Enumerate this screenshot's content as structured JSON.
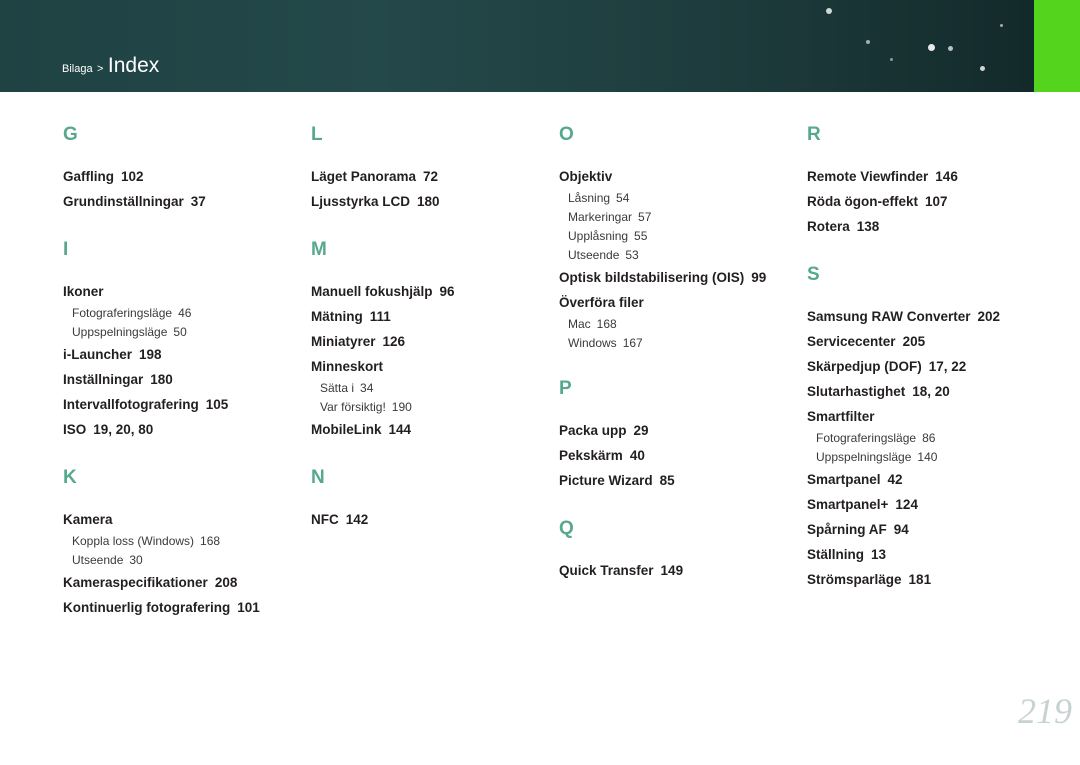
{
  "header": {
    "breadcrumb_parent": "Bilaga",
    "breadcrumb_separator": ">",
    "title": "Index",
    "accent_color": "#55d41d",
    "background_color": "#1f4243"
  },
  "colors": {
    "letter": "#57a88e",
    "text": "#231f20",
    "page_number": "#c7d2d2"
  },
  "columns": [
    {
      "sections": [
        {
          "letter": "G",
          "entries": [
            {
              "text": "Gaffling",
              "page": "102"
            },
            {
              "text": "Grundinställningar",
              "page": "37"
            }
          ]
        },
        {
          "letter": "I",
          "entries": [
            {
              "text": "Ikoner",
              "page": "",
              "subs": [
                {
                  "text": "Fotograferingsläge",
                  "page": "46"
                },
                {
                  "text": "Uppspelningsläge",
                  "page": "50"
                }
              ]
            },
            {
              "text": "i-Launcher",
              "page": "198"
            },
            {
              "text": "Inställningar",
              "page": "180"
            },
            {
              "text": "Intervallfotografering",
              "page": "105"
            },
            {
              "text": "ISO",
              "page": "19, 20, 80"
            }
          ]
        },
        {
          "letter": "K",
          "entries": [
            {
              "text": "Kamera",
              "page": "",
              "subs": [
                {
                  "text": "Koppla loss (Windows)",
                  "page": "168"
                },
                {
                  "text": "Utseende",
                  "page": "30"
                }
              ]
            },
            {
              "text": "Kameraspecifikationer",
              "page": "208"
            },
            {
              "text": "Kontinuerlig fotografering",
              "page": "101"
            }
          ]
        }
      ]
    },
    {
      "sections": [
        {
          "letter": "L",
          "entries": [
            {
              "text": "Läget Panorama",
              "page": "72"
            },
            {
              "text": "Ljusstyrka LCD",
              "page": "180"
            }
          ]
        },
        {
          "letter": "M",
          "entries": [
            {
              "text": "Manuell fokushjälp",
              "page": "96"
            },
            {
              "text": "Mätning",
              "page": "111"
            },
            {
              "text": "Miniatyrer",
              "page": "126"
            },
            {
              "text": "Minneskort",
              "page": "",
              "subs": [
                {
                  "text": "Sätta i",
                  "page": "34"
                },
                {
                  "text": "Var försiktig!",
                  "page": "190"
                }
              ]
            },
            {
              "text": "MobileLink",
              "page": "144"
            }
          ]
        },
        {
          "letter": "N",
          "entries": [
            {
              "text": "NFC",
              "page": "142"
            }
          ]
        }
      ]
    },
    {
      "sections": [
        {
          "letter": "O",
          "entries": [
            {
              "text": "Objektiv",
              "page": "",
              "subs": [
                {
                  "text": "Låsning",
                  "page": "54"
                },
                {
                  "text": "Markeringar",
                  "page": "57"
                },
                {
                  "text": "Upplåsning",
                  "page": "55"
                },
                {
                  "text": "Utseende",
                  "page": "53"
                }
              ]
            },
            {
              "text": "Optisk bildstabilisering (OIS)",
              "page": "99"
            },
            {
              "text": "Överföra filer",
              "page": "",
              "subs": [
                {
                  "text": "Mac",
                  "page": "168"
                },
                {
                  "text": "Windows",
                  "page": "167"
                }
              ]
            }
          ]
        },
        {
          "letter": "P",
          "entries": [
            {
              "text": "Packa upp",
              "page": "29"
            },
            {
              "text": "Pekskärm",
              "page": "40"
            },
            {
              "text": "Picture Wizard",
              "page": "85"
            }
          ]
        },
        {
          "letter": "Q",
          "entries": [
            {
              "text": "Quick Transfer",
              "page": "149"
            }
          ]
        }
      ]
    },
    {
      "sections": [
        {
          "letter": "R",
          "entries": [
            {
              "text": "Remote Viewfinder",
              "page": "146"
            },
            {
              "text": "Röda ögon-effekt",
              "page": "107"
            },
            {
              "text": "Rotera",
              "page": "138"
            }
          ]
        },
        {
          "letter": "S",
          "entries": [
            {
              "text": "Samsung RAW Converter",
              "page": "202"
            },
            {
              "text": "Servicecenter",
              "page": "205"
            },
            {
              "text": "Skärpedjup (DOF)",
              "page": "17, 22"
            },
            {
              "text": "Slutarhastighet",
              "page": "18, 20"
            },
            {
              "text": "Smartfilter",
              "page": "",
              "subs": [
                {
                  "text": "Fotograferingsläge",
                  "page": "86"
                },
                {
                  "text": "Uppspelningsläge",
                  "page": "140"
                }
              ]
            },
            {
              "text": "Smartpanel",
              "page": "42"
            },
            {
              "text": "Smartpanel+",
              "page": "124"
            },
            {
              "text": "Spårning AF",
              "page": "94"
            },
            {
              "text": "Ställning",
              "page": "13"
            },
            {
              "text": "Strömsparläge",
              "page": "181"
            }
          ]
        }
      ]
    }
  ],
  "page_number": "219"
}
